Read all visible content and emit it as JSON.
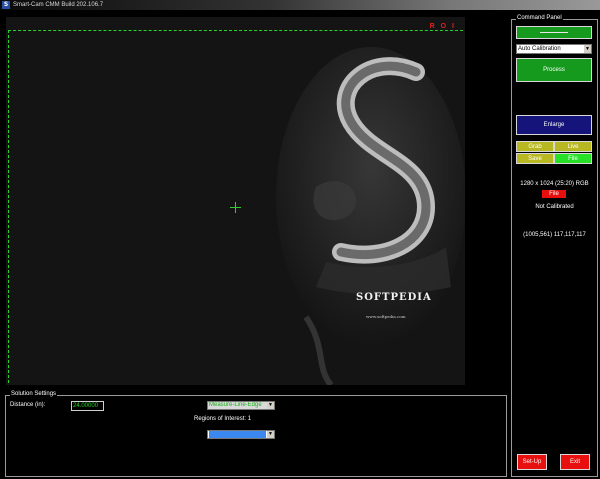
{
  "window": {
    "title": "Smart-Cam CMM Build 202.106.7",
    "icon": "app-icon",
    "icon_glyph": "S"
  },
  "viewer": {
    "roi_label": "R O I",
    "image_caption": "SOFTPEDIA",
    "image_url_text": "www.softpedia.com",
    "crosshair_color": "#2ad12a"
  },
  "solution_settings": {
    "legend": "Solution Settings",
    "distance_label": "Distance (in):",
    "distance_value": "24.00000",
    "measure_select_value": "Measure-Line-Edge",
    "regions_label": "Regions of Interest: 1",
    "roi_select_value": ""
  },
  "command_panel": {
    "legend": "Command Panel",
    "calibration_select": "Auto Calibration",
    "process_label": "Process",
    "enlarge_label": "Enlarge",
    "grab_label": "Grab",
    "live_label": "Live",
    "save_label": "Save",
    "file_label": "File",
    "resolution_text": "1280 x 1024 (25:20) RGB",
    "file_red_label": "File",
    "calibration_status": "Not Calibrated",
    "pixel_readout": "(1005,561) 117,117,117",
    "setup_label": "Set-Up",
    "exit_label": "Exit"
  },
  "colors": {
    "accent_green": "#169a1e",
    "bright_green": "#27e027",
    "navy": "#14147a",
    "olive": "#b8b822",
    "red": "#e80f0f",
    "roi_dash": "#2ad12a"
  }
}
